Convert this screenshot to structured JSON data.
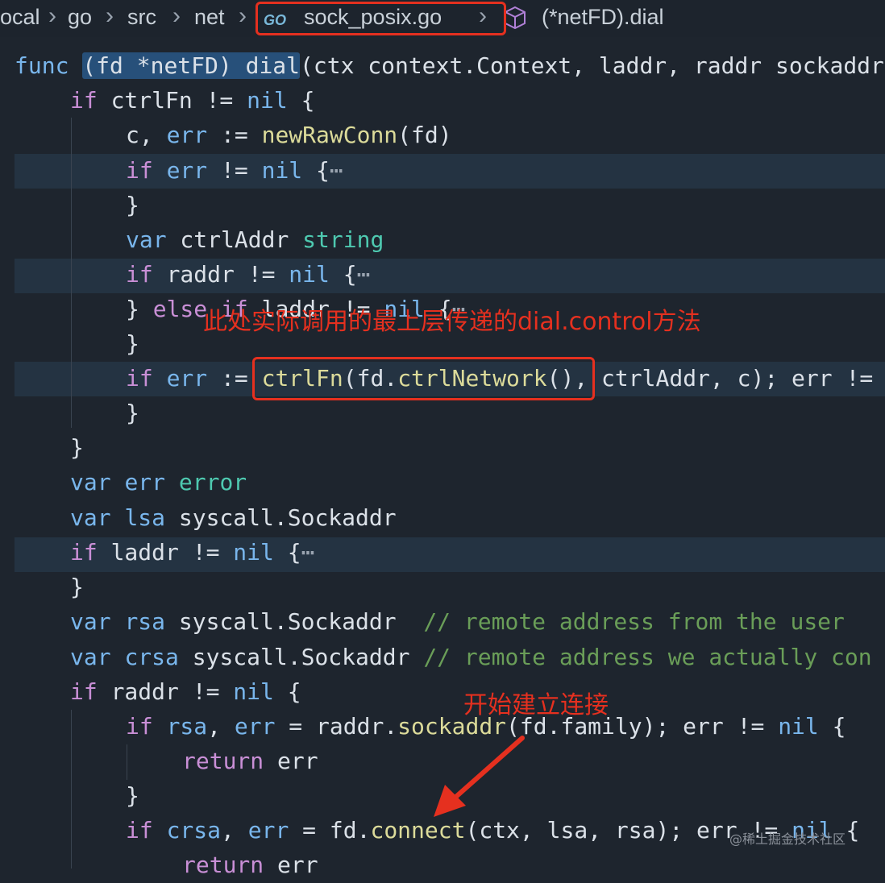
{
  "breadcrumb": {
    "items": [
      "ocal",
      "go",
      "src",
      "net",
      "sock_posix.go",
      "(*netFD).dial"
    ],
    "separator": "›",
    "file_icon": "go-file-icon",
    "file_icon_text": "GO",
    "symbol_icon": "cube-icon"
  },
  "code": {
    "l1": {
      "t1": "func ",
      "sel": "(fd *netFD) dial",
      "t3": "(ctx context.Context, laddr, raddr sockaddr"
    },
    "l2": {
      "a": "if",
      "b": " ctrlFn != ",
      "c": "nil",
      "d": " {"
    },
    "l3": {
      "a": "c, ",
      "b": "err",
      "c": " := ",
      "d": "newRawConn",
      "e": "(fd)"
    },
    "l4": {
      "a": "if",
      "b": " ",
      "c": "err",
      "d": " != ",
      "e": "nil",
      "f": " {",
      "g": "⋯"
    },
    "l5": {
      "a": "}"
    },
    "l6": {
      "a": "var",
      "b": " ctrlAddr ",
      "c": "string"
    },
    "l7": {
      "a": "if",
      "b": " raddr != ",
      "c": "nil",
      "d": " {",
      "e": "⋯"
    },
    "l8": {
      "a": "} ",
      "b": "else",
      "c": " ",
      "d": "if",
      "e": " laddr != ",
      "f": "nil",
      "g": " {",
      "h": "⋯"
    },
    "l9": {
      "a": "}"
    },
    "l10": {
      "a": "if",
      "b": " ",
      "c": "err",
      "d": " := ",
      "e": "ctrlFn",
      "f": "(fd.",
      "g": "ctrlNetwork",
      "h": "(), ctrlAddr, c); err !="
    },
    "l11": {
      "a": "}"
    },
    "l12": {
      "a": "}"
    },
    "l13": {
      "a": "var",
      "b": " ",
      "c": "err",
      "d": " ",
      "e": "error"
    },
    "l14": {
      "a": "var",
      "b": " ",
      "c": "lsa",
      "d": " syscall.Sockaddr"
    },
    "l15": {
      "a": "if",
      "b": " laddr != ",
      "c": "nil",
      "d": " {",
      "e": "⋯"
    },
    "l16": {
      "a": "}"
    },
    "l17": {
      "a": "var",
      "b": " ",
      "c": "rsa",
      "d": " syscall.Sockaddr  ",
      "e": "// remote address from the user"
    },
    "l18": {
      "a": "var",
      "b": " ",
      "c": "crsa",
      "d": " syscall.Sockaddr ",
      "e": "// remote address we actually con"
    },
    "l19": {
      "a": "if",
      "b": " raddr != ",
      "c": "nil",
      "d": " {"
    },
    "l20": {
      "a": "if",
      "b": " ",
      "c": "rsa",
      "d": ", ",
      "e": "err",
      "f": " = raddr.",
      "g": "sockaddr",
      "h": "(fd.family); err != ",
      "i": "nil",
      "j": " {"
    },
    "l21": {
      "a": "return",
      "b": " err"
    },
    "l22": {
      "a": "}"
    },
    "l23": {
      "a": "if",
      "b": " ",
      "c": "crsa",
      "d": ", ",
      "e": "err",
      "f": " = fd.",
      "g": "connect",
      "h": "(ctx, lsa, rsa); err != ",
      "i": "nil",
      "j": " {"
    },
    "l24": {
      "a": "return",
      "b": " err"
    }
  },
  "annotations": {
    "ctrl_note": "此处实际调用的最上层传递的dial.control方法",
    "connect_note": "开始建立连接"
  },
  "watermark": "@稀土掘金技术社区",
  "colors": {
    "background": "#1e252e",
    "annotation_red": "#e5301f",
    "keyword": "#79b6ec",
    "control_keyword": "#c98fd6",
    "type": "#4ec9b0",
    "function": "#dcdb9a",
    "comment": "#6a9e58",
    "selection": "#27507a"
  }
}
